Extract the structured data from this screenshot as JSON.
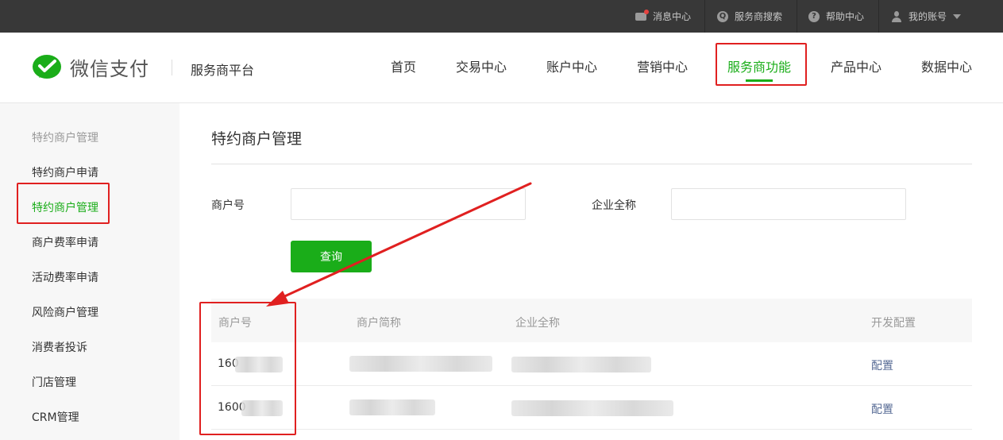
{
  "topbar": {
    "messages": "消息中心",
    "search": "服务商搜索",
    "help": "帮助中心",
    "account": "我的账号"
  },
  "header": {
    "brand": "微信支付",
    "platform": "服务商平台",
    "nav": [
      "首页",
      "交易中心",
      "账户中心",
      "营销中心",
      "服务商功能",
      "产品中心",
      "数据中心"
    ],
    "active_nav": "服务商功能"
  },
  "sidebar": {
    "group": "特约商户管理",
    "items": [
      "特约商户申请",
      "特约商户管理",
      "商户费率申请",
      "活动费率申请",
      "风险商户管理",
      "消费者投诉",
      "门店管理",
      "CRM管理"
    ],
    "active_item": "特约商户管理"
  },
  "main": {
    "title": "特约商户管理",
    "form": {
      "merchant_id_label": "商户号",
      "merchant_id_value": "",
      "company_label": "企业全称",
      "company_value": "",
      "query_button": "查询"
    },
    "table": {
      "headers": [
        "商户号",
        "商户简称",
        "企业全称",
        "开发配置"
      ],
      "rows": [
        {
          "merchant_id": "160",
          "short_name": "",
          "company": "",
          "action": "配置"
        },
        {
          "merchant_id": "1600",
          "short_name": "",
          "company": "",
          "action": "配置"
        }
      ]
    }
  },
  "colors": {
    "brand_green": "#1aad19",
    "topbar_bg": "#383838",
    "link_blue": "#576b95",
    "annotation_red": "#e02020"
  },
  "icons": [
    "mail-icon",
    "search-icon",
    "help-icon",
    "user-icon",
    "caret-down-icon",
    "wechat-pay-logo-icon"
  ]
}
